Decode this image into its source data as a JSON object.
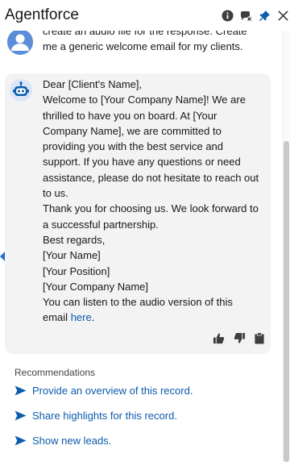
{
  "header": {
    "title": "Agentforce",
    "icons": [
      "info-icon",
      "hide-chat-icon",
      "pin-icon",
      "close-icon"
    ]
  },
  "user_message": {
    "line1": "create an audio file for the response. Create",
    "line2": "me a generic welcome email for my clients."
  },
  "bot_message": {
    "lines": [
      "Dear [Client's Name],",
      "Welcome to [Your Company Name]! We are",
      "thrilled to have you on board. At [Your",
      "Company Name], we are committed to",
      "providing you with the best service and",
      "support. If you have any questions or need",
      "assistance, please do not hesitate to reach out",
      "to us.",
      "Thank you for choosing us. We look forward to",
      "a successful partnership.",
      "Best regards,",
      "[Your Name]",
      "[Your Position]",
      "[Your Company Name]",
      "You can listen to the audio version of this"
    ],
    "last_line_prefix": "email ",
    "link_text": "here",
    "last_line_suffix": "."
  },
  "feedback_icons": [
    "thumbs-up-icon",
    "thumbs-down-icon",
    "copy-icon"
  ],
  "recommendations": {
    "heading": "Recommendations",
    "items": [
      "Provide an overview of this record.",
      "Share highlights for this record.",
      "Show new leads."
    ]
  },
  "colors": {
    "link": "#0b5cab",
    "accent": "#2a6fd6",
    "bubble": "#f3f3f3",
    "text": "#181818"
  }
}
